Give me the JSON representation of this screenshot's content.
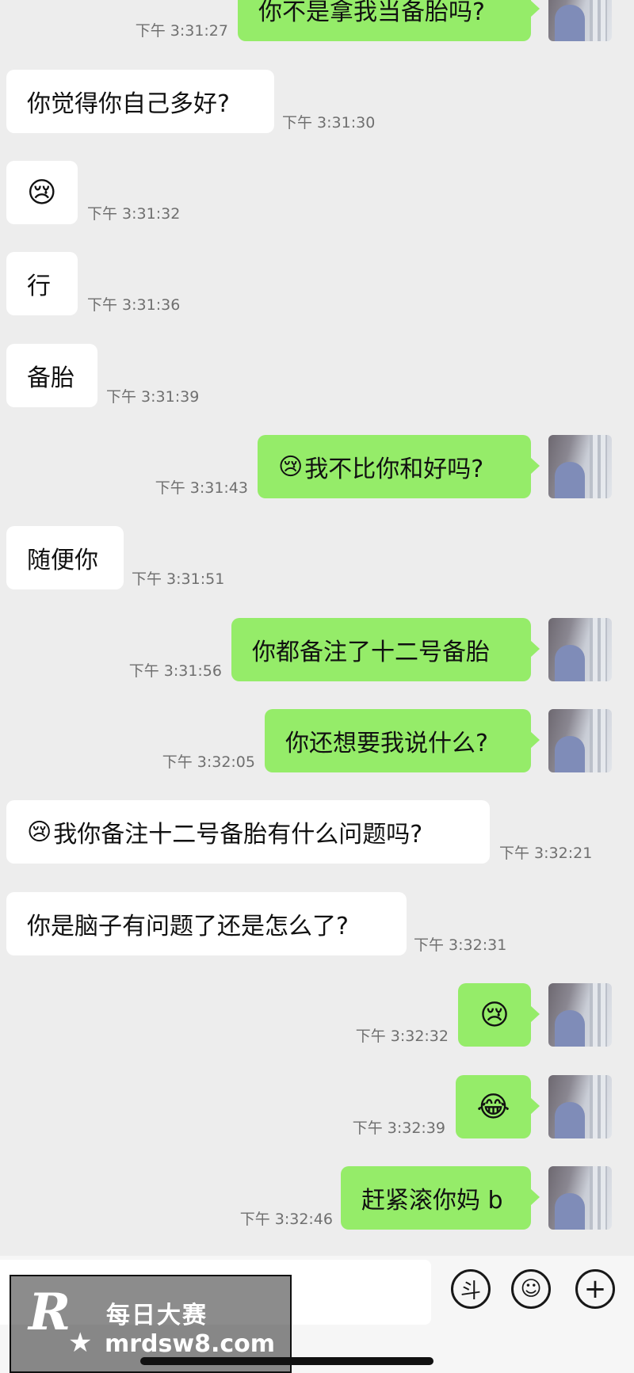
{
  "messages": [
    {
      "dir": "out",
      "text": "你不是拿我当备胎吗?",
      "time": "下午 3:31:27"
    },
    {
      "dir": "in",
      "text": "你觉得你自己多好?",
      "time": "下午 3:31:30"
    },
    {
      "dir": "in",
      "emoji": "😢",
      "time": "下午 3:31:32"
    },
    {
      "dir": "in",
      "text": "行",
      "time": "下午 3:31:36"
    },
    {
      "dir": "in",
      "text": "备胎",
      "time": "下午 3:31:39"
    },
    {
      "dir": "out",
      "emoji": "😢",
      "text": "我不比你和好吗?",
      "time": "下午 3:31:43"
    },
    {
      "dir": "in",
      "text": "随便你",
      "time": "下午 3:31:51"
    },
    {
      "dir": "out",
      "text": "你都备注了十二号备胎",
      "time": "下午 3:31:56"
    },
    {
      "dir": "out",
      "text": "你还想要我说什么?",
      "time": "下午 3:32:05"
    },
    {
      "dir": "in",
      "emoji": "😢",
      "text": "我你备注十二号备胎有什么问题吗?",
      "time": "下午 3:32:21"
    },
    {
      "dir": "in",
      "text": "你是脑子有问题了还是怎么了?",
      "time": "下午 3:32:31"
    },
    {
      "dir": "out",
      "emoji": "😢",
      "time": "下午 3:32:32"
    },
    {
      "dir": "out",
      "emoji": "😂",
      "time": "下午 3:32:39"
    },
    {
      "dir": "out",
      "text": "赶紧滚你妈 b",
      "time": "下午 3:32:46"
    }
  ],
  "input_bar": {
    "placeholder": "",
    "douyin_icon": "斗",
    "emoji_icon": "☺",
    "plus_icon": "+"
  },
  "watermark": {
    "logo_letter": "R",
    "logo_star": "★",
    "title": "每日大赛",
    "url": "mrdsw8.com"
  }
}
